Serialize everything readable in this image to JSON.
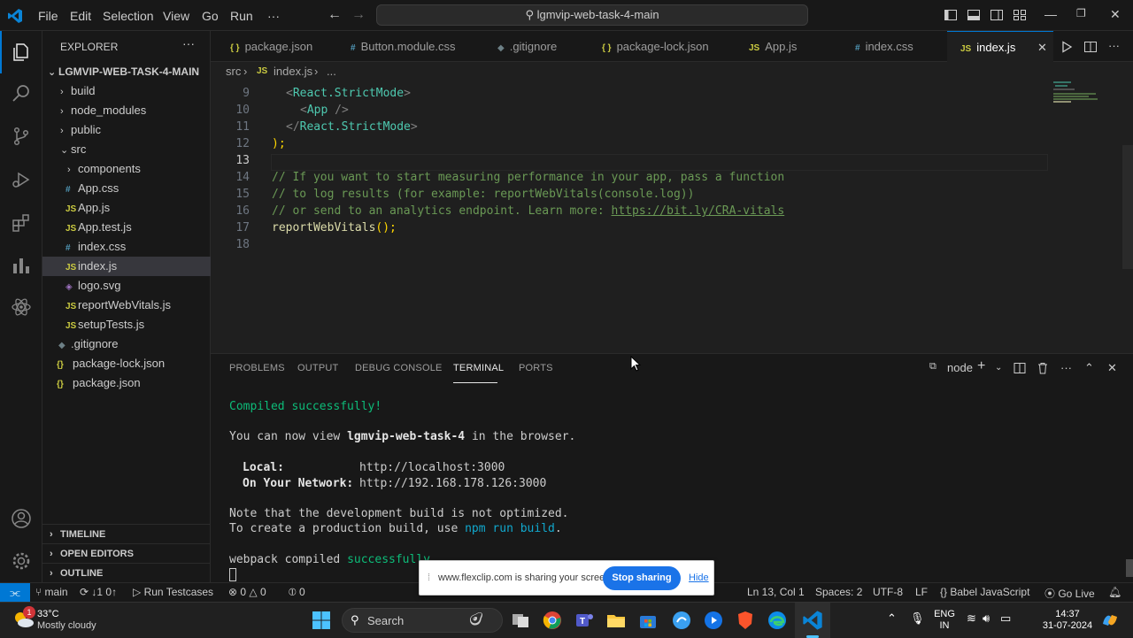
{
  "title_bar": {
    "menus": [
      "File",
      "Edit",
      "Selection",
      "View",
      "Go",
      "Run",
      "···"
    ],
    "command_center": "lgmvip-web-task-4-main"
  },
  "sidebar": {
    "title": "EXPLORER",
    "more": "···",
    "root": "LGMVIP-WEB-TASK-4-MAIN",
    "items": [
      {
        "label": "build",
        "kind": "folder"
      },
      {
        "label": "node_modules",
        "kind": "folder"
      },
      {
        "label": "public",
        "kind": "folder"
      },
      {
        "label": "src",
        "kind": "folder-open"
      },
      {
        "label": "components",
        "kind": "folder"
      },
      {
        "label": "App.css",
        "kind": "css"
      },
      {
        "label": "App.js",
        "kind": "js"
      },
      {
        "label": "App.test.js",
        "kind": "js"
      },
      {
        "label": "index.css",
        "kind": "css"
      },
      {
        "label": "index.js",
        "kind": "js"
      },
      {
        "label": "logo.svg",
        "kind": "svg"
      },
      {
        "label": "reportWebVitals.js",
        "kind": "js"
      },
      {
        "label": "setupTests.js",
        "kind": "js"
      },
      {
        "label": ".gitignore",
        "kind": "git"
      },
      {
        "label": "package-lock.json",
        "kind": "json"
      },
      {
        "label": "package.json",
        "kind": "json"
      }
    ],
    "sections": [
      "TIMELINE",
      "OPEN EDITORS",
      "OUTLINE"
    ]
  },
  "tabs": [
    {
      "label": "package.json",
      "icon": "{ }"
    },
    {
      "label": "Button.module.css",
      "icon": "#"
    },
    {
      "label": ".gitignore",
      "icon": "◆"
    },
    {
      "label": "package-lock.json",
      "icon": "{ }"
    },
    {
      "label": "App.js",
      "icon": "JS"
    },
    {
      "label": "index.css",
      "icon": "#"
    },
    {
      "label": "index.js",
      "icon": "JS"
    }
  ],
  "breadcrumb": {
    "folder": "src",
    "file": "index.js",
    "tail": "..."
  },
  "editor": {
    "line_numbers": [
      "9",
      "10",
      "11",
      "12",
      "13",
      "14",
      "15",
      "16",
      "17",
      "18"
    ],
    "lines": {
      "l9_tag": "React.StrictMode",
      "l10_tag": "App",
      "l11_tag": "React.StrictMode",
      "l12": ");",
      "l14": "// If you want to start measuring performance in your app, pass a function",
      "l15": "// to log results (for example: reportWebVitals(console.log))",
      "l16_text": "// or send to an analytics endpoint. Learn more: ",
      "l16_link": "https://bit.ly/CRA-vitals",
      "l17_fn": "reportWebVitals",
      "l17_rest": "();"
    }
  },
  "panel": {
    "tabs": [
      "PROBLEMS",
      "OUTPUT",
      "DEBUG CONSOLE",
      "TERMINAL",
      "PORTS"
    ],
    "terminal_name": "node",
    "terminal": {
      "compiled": "Compiled successfully!",
      "view_pre": "You can now view ",
      "view_app": "lgmvip-web-task-4",
      "view_post": " in the browser.",
      "local_label": "Local:",
      "local_url": "http://localhost:3000",
      "net_label": "On Your Network:",
      "net_url": "http://192.168.178.126:3000",
      "note": "Note that the development build is not optimized.",
      "prod_pre": "To create a production build, use ",
      "prod_cmd": "npm run build",
      "prod_post": ".",
      "webpack_pre": "webpack compiled ",
      "webpack_ok": "successfully"
    }
  },
  "share_bar": {
    "message": "www.flexclip.com is sharing your screen.",
    "stop": "Stop sharing",
    "hide": "Hide"
  },
  "status": {
    "branch": "main",
    "sync": "↓1 0↑",
    "run": "Run Testcases",
    "errors": "0",
    "warnings": "0",
    "ports": "0",
    "position": "Ln 13, Col 1",
    "spaces": "Spaces: 2",
    "encoding": "UTF-8",
    "eol": "LF",
    "language": "Babel JavaScript",
    "golive": "Go Live"
  },
  "taskbar": {
    "weather_temp": "33°C",
    "weather_desc": "Mostly cloudy",
    "weather_badge": "1",
    "search": "Search",
    "lang1": "ENG",
    "lang2": "IN",
    "time": "14:37",
    "date": "31-07-2024"
  }
}
